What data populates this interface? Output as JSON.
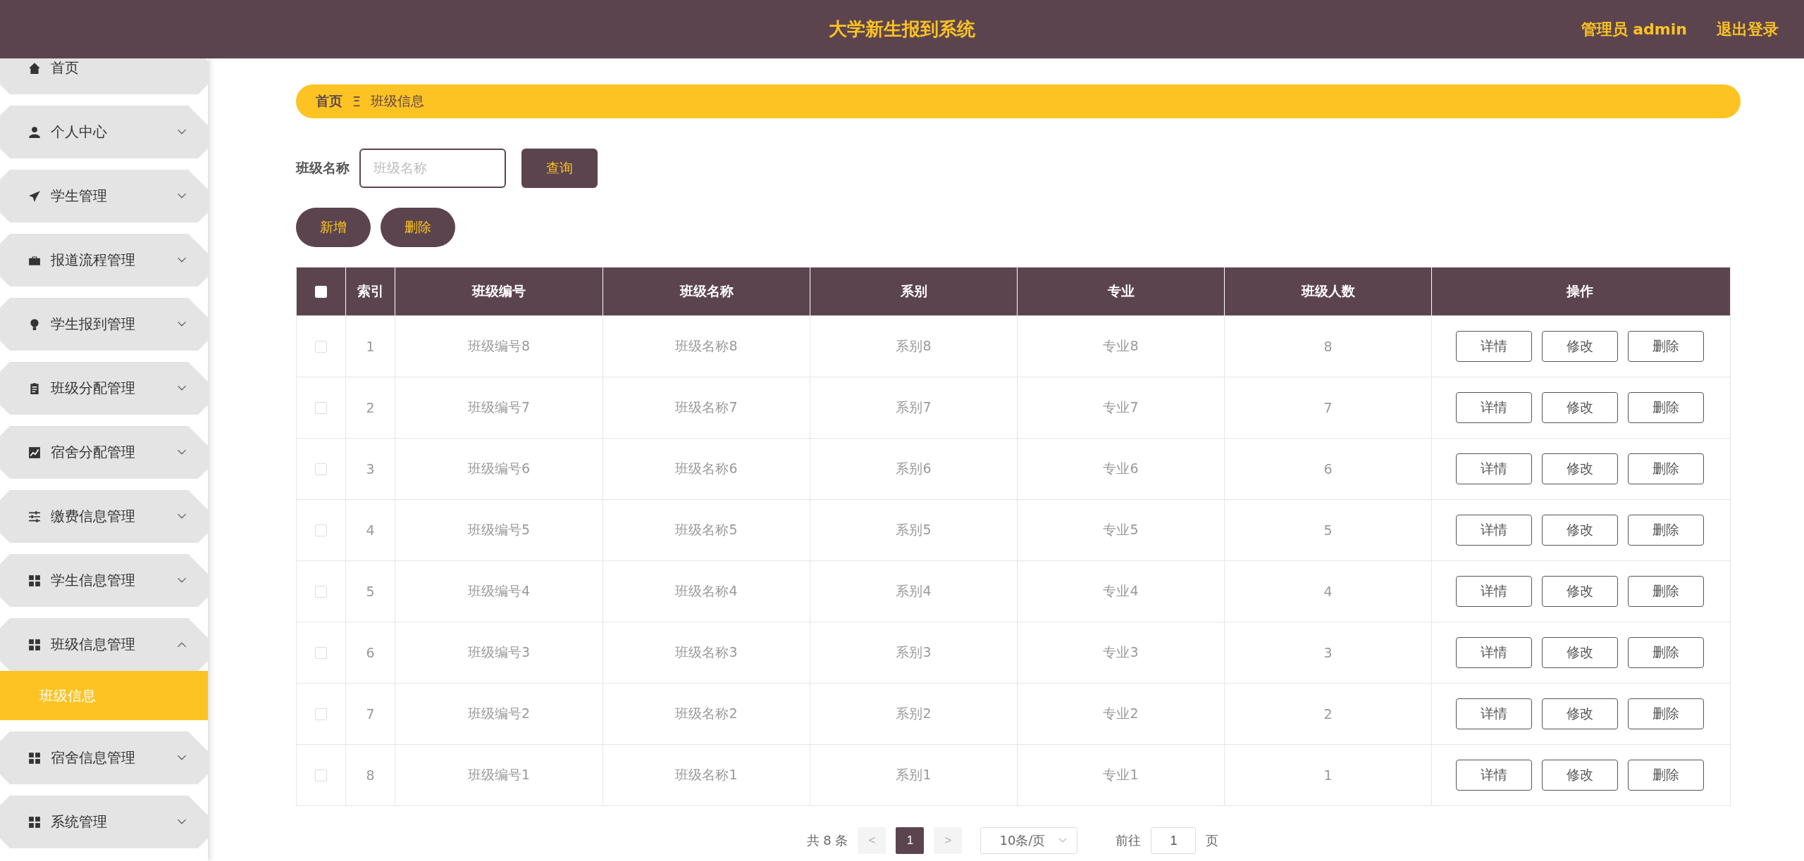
{
  "header": {
    "title": "大学新生报到系统",
    "user": "管理员 admin",
    "logout": "退出登录"
  },
  "sidebar": {
    "items": [
      {
        "label": "首页",
        "has_children": false
      },
      {
        "label": "个人中心",
        "expanded": false,
        "has_children": true
      },
      {
        "label": "学生管理",
        "expanded": false,
        "has_children": true
      },
      {
        "label": "报道流程管理",
        "expanded": false,
        "has_children": true
      },
      {
        "label": "学生报到管理",
        "expanded": false,
        "has_children": true
      },
      {
        "label": "班级分配管理",
        "expanded": false,
        "has_children": true
      },
      {
        "label": "宿舍分配管理",
        "expanded": false,
        "has_children": true
      },
      {
        "label": "缴费信息管理",
        "expanded": false,
        "has_children": true
      },
      {
        "label": "学生信息管理",
        "expanded": false,
        "has_children": true
      },
      {
        "label": "班级信息管理",
        "expanded": true,
        "has_children": true,
        "children": [
          {
            "label": "班级信息",
            "selected": true
          }
        ]
      },
      {
        "label": "宿舍信息管理",
        "expanded": false,
        "has_children": true
      },
      {
        "label": "系统管理",
        "expanded": false,
        "has_children": true
      }
    ]
  },
  "breadcrumb": {
    "home": "首页",
    "separator": "Ξ",
    "current": "班级信息"
  },
  "search": {
    "label": "班级名称",
    "placeholder": "班级名称",
    "button": "查询"
  },
  "actions": [
    "新增",
    "删除"
  ],
  "table": {
    "header_checked": false,
    "columns": [
      "索引",
      "班级编号",
      "班级名称",
      "系别",
      "专业",
      "班级人数",
      "操作"
    ],
    "rows": [
      {
        "checked": false,
        "cells": [
          "1",
          "班级编号8",
          "班级名称8",
          "系别8",
          "专业8",
          "8"
        ],
        "actions": [
          "详情",
          "修改",
          "删除"
        ]
      },
      {
        "checked": false,
        "cells": [
          "2",
          "班级编号7",
          "班级名称7",
          "系别7",
          "专业7",
          "7"
        ],
        "actions": [
          "详情",
          "修改",
          "删除"
        ]
      },
      {
        "checked": false,
        "cells": [
          "3",
          "班级编号6",
          "班级名称6",
          "系别6",
          "专业6",
          "6"
        ],
        "actions": [
          "详情",
          "修改",
          "删除"
        ]
      },
      {
        "checked": false,
        "cells": [
          "4",
          "班级编号5",
          "班级名称5",
          "系别5",
          "专业5",
          "5"
        ],
        "actions": [
          "详情",
          "修改",
          "删除"
        ]
      },
      {
        "checked": false,
        "cells": [
          "5",
          "班级编号4",
          "班级名称4",
          "系别4",
          "专业4",
          "4"
        ],
        "actions": [
          "详情",
          "修改",
          "删除"
        ]
      },
      {
        "checked": false,
        "cells": [
          "6",
          "班级编号3",
          "班级名称3",
          "系别3",
          "专业3",
          "3"
        ],
        "actions": [
          "详情",
          "修改",
          "删除"
        ]
      },
      {
        "checked": false,
        "cells": [
          "7",
          "班级编号2",
          "班级名称2",
          "系别2",
          "专业2",
          "2"
        ],
        "actions": [
          "详情",
          "修改",
          "删除"
        ]
      },
      {
        "checked": false,
        "cells": [
          "8",
          "班级编号1",
          "班级名称1",
          "系别1",
          "专业1",
          "1"
        ],
        "actions": [
          "详情",
          "修改",
          "删除"
        ]
      }
    ]
  },
  "pagination": {
    "total": "共 8 条",
    "prev": "<",
    "pages": [
      {
        "label": "1",
        "selected": true
      }
    ],
    "next": ">",
    "page_size": "10条/页",
    "goto": "前往",
    "goto_value": "1",
    "page_unit": "页"
  }
}
